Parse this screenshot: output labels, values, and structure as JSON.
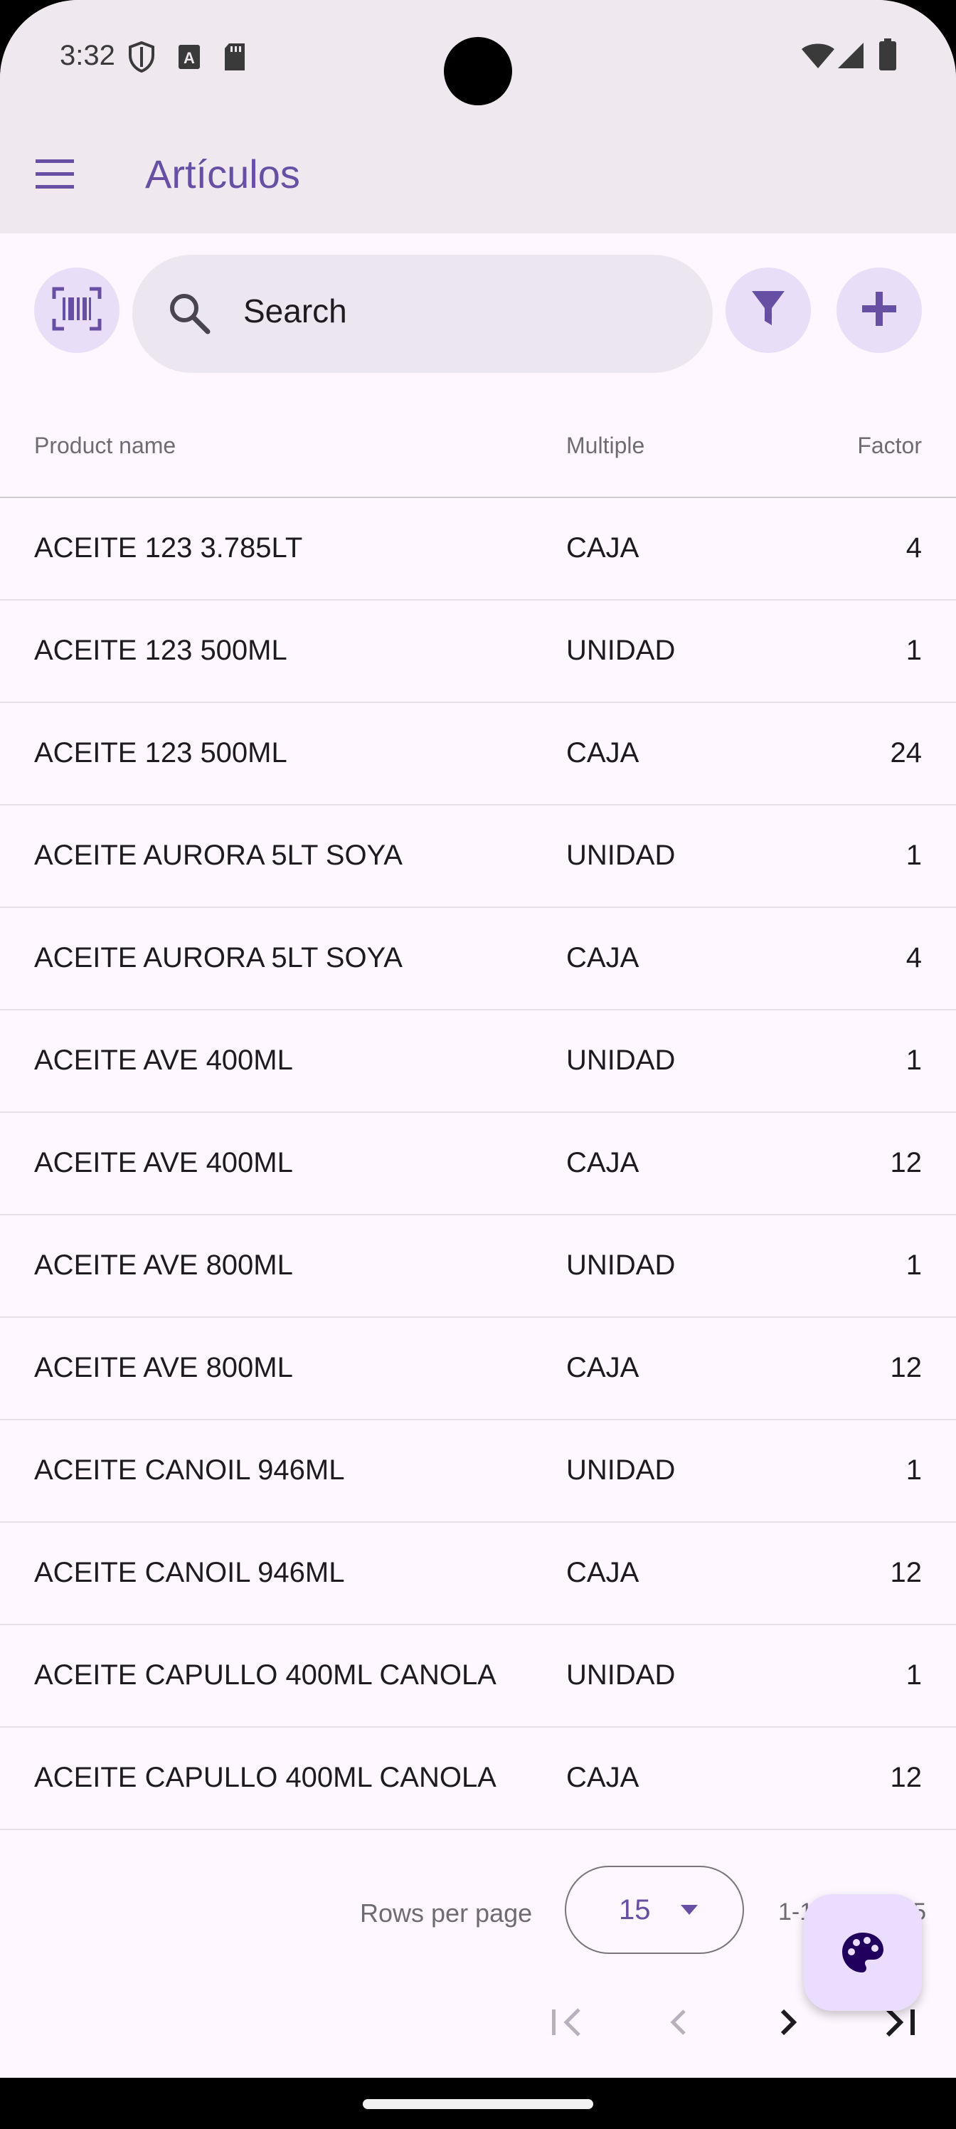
{
  "status_bar": {
    "time": "3:32",
    "icons": [
      "shield-icon",
      "text-icon",
      "sd-card-icon",
      "wifi-icon",
      "signal-icon",
      "battery-icon"
    ]
  },
  "app_bar": {
    "title": "Artículos",
    "menu_icon": "hamburger-menu-icon"
  },
  "toolbar": {
    "scan_icon": "barcode-scan-icon",
    "search_placeholder": "Search",
    "filter_icon": "filter-icon",
    "add_icon": "plus-icon"
  },
  "table": {
    "columns": [
      "Product name",
      "Multiple",
      "Factor"
    ],
    "rows": [
      {
        "name": "ACEITE 123 3.785LT",
        "multiple": "CAJA",
        "factor": "4"
      },
      {
        "name": "ACEITE 123 500ML",
        "multiple": "UNIDAD",
        "factor": "1"
      },
      {
        "name": "ACEITE 123 500ML",
        "multiple": "CAJA",
        "factor": "24"
      },
      {
        "name": "ACEITE AURORA 5LT SOYA",
        "multiple": "UNIDAD",
        "factor": "1"
      },
      {
        "name": "ACEITE AURORA 5LT SOYA",
        "multiple": "CAJA",
        "factor": "4"
      },
      {
        "name": "ACEITE AVE 400ML",
        "multiple": "UNIDAD",
        "factor": "1"
      },
      {
        "name": "ACEITE AVE 400ML",
        "multiple": "CAJA",
        "factor": "12"
      },
      {
        "name": "ACEITE AVE 800ML",
        "multiple": "UNIDAD",
        "factor": "1"
      },
      {
        "name": "ACEITE AVE 800ML",
        "multiple": "CAJA",
        "factor": "12"
      },
      {
        "name": "ACEITE CANOIL 946ML",
        "multiple": "UNIDAD",
        "factor": "1"
      },
      {
        "name": "ACEITE CANOIL 946ML",
        "multiple": "CAJA",
        "factor": "12"
      },
      {
        "name": "ACEITE CAPULLO 400ML CANOLA",
        "multiple": "UNIDAD",
        "factor": "1"
      },
      {
        "name": "ACEITE CAPULLO 400ML CANOLA",
        "multiple": "CAJA",
        "factor": "12"
      }
    ]
  },
  "pagination": {
    "rows_per_page_label": "Rows per page",
    "rows_per_page_value": "15",
    "range_text": "1-1",
    "range_suffix": "5",
    "buttons": [
      "first-page-icon",
      "previous-page-icon",
      "next-page-icon",
      "last-page-icon"
    ]
  },
  "fab": {
    "icon": "palette-icon"
  },
  "colors": {
    "primary": "#6750a4",
    "surface": "#fef7ff",
    "app_bar": "#efe9ef",
    "tonal_button": "#e8def8",
    "fab": "#eaddff"
  }
}
